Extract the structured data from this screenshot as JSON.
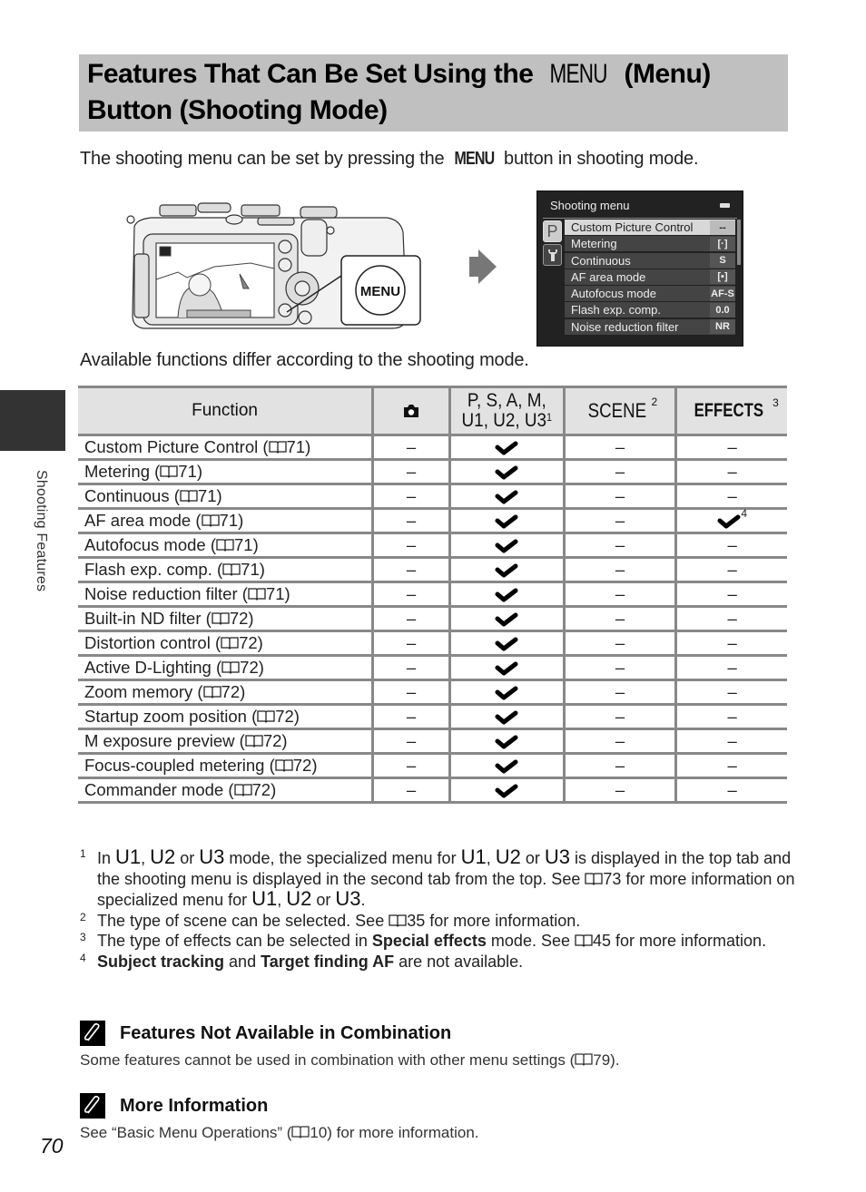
{
  "page": {
    "title_line1_pre": "Features That Can Be Set Using the ",
    "title_menu_glyph": "MENU",
    "title_line1_post": " (Menu)",
    "title_line2": "Button (Shooting Mode)",
    "intro_pre": "The shooting menu can be set by pressing the ",
    "intro_menu": "MENU",
    "intro_post": " button in shooting mode.",
    "available_text": "Available functions differ according to the shooting mode.",
    "side_label": "Shooting Features",
    "page_number": "70"
  },
  "illustration": {
    "camera_button_label": "MENU",
    "menu_screen": {
      "title": "Shooting menu",
      "tabs": [
        {
          "icon": "P",
          "name": "shooting-mode-tab",
          "active": true
        },
        {
          "icon": "wrench",
          "name": "setup-tab",
          "active": false
        }
      ],
      "items": [
        {
          "label": "Custom Picture Control",
          "value": "--",
          "selected": true
        },
        {
          "label": "Metering",
          "value": "[·]",
          "selected": false
        },
        {
          "label": "Continuous",
          "value": "S",
          "selected": false
        },
        {
          "label": "AF area mode",
          "value": "[▪]",
          "selected": false
        },
        {
          "label": "Autofocus mode",
          "value": "AF-S",
          "selected": false
        },
        {
          "label": "Flash exp. comp.",
          "value": "0.0",
          "selected": false
        },
        {
          "label": "Noise reduction filter",
          "value": "NR",
          "selected": false
        }
      ]
    }
  },
  "table": {
    "headers": {
      "function": "Function",
      "auto": "camera-icon",
      "psam_line1": "P, S, A, M,",
      "psam_line2": "U1, U2, U3",
      "psam_sup": "1",
      "scene": "SCENE",
      "scene_sup": "2",
      "effects": "EFFECTS",
      "effects_sup": "3"
    },
    "dash": "–",
    "rows": [
      {
        "function": "Custom Picture Control (",
        "page": "71)",
        "auto": "–",
        "psam": "check",
        "scene": "–",
        "effects": "–"
      },
      {
        "function": "Metering (",
        "page": "71)",
        "auto": "–",
        "psam": "check",
        "scene": "–",
        "effects": "–"
      },
      {
        "function": "Continuous (",
        "page": "71)",
        "auto": "–",
        "psam": "check",
        "scene": "–",
        "effects": "–"
      },
      {
        "function": "AF area mode (",
        "page": "71)",
        "auto": "–",
        "psam": "check",
        "scene": "–",
        "effects": "check",
        "effects_sup": "4"
      },
      {
        "function": "Autofocus mode (",
        "page": "71)",
        "auto": "–",
        "psam": "check",
        "scene": "–",
        "effects": "–"
      },
      {
        "function": "Flash exp. comp. (",
        "page": "71)",
        "auto": "–",
        "psam": "check",
        "scene": "–",
        "effects": "–"
      },
      {
        "function": "Noise reduction filter (",
        "page": "71)",
        "auto": "–",
        "psam": "check",
        "scene": "–",
        "effects": "–"
      },
      {
        "function": "Built-in ND filter (",
        "page": "72)",
        "auto": "–",
        "psam": "check",
        "scene": "–",
        "effects": "–"
      },
      {
        "function": "Distortion control (",
        "page": "72)",
        "auto": "–",
        "psam": "check",
        "scene": "–",
        "effects": "–"
      },
      {
        "function": "Active D-Lighting (",
        "page": "72)",
        "auto": "–",
        "psam": "check",
        "scene": "–",
        "effects": "–"
      },
      {
        "function": "Zoom memory (",
        "page": "72)",
        "auto": "–",
        "psam": "check",
        "scene": "–",
        "effects": "–"
      },
      {
        "function": "Startup zoom position (",
        "page": "72)",
        "auto": "–",
        "psam": "check",
        "scene": "–",
        "effects": "–"
      },
      {
        "function": "M exposure preview (",
        "page": "72)",
        "auto": "–",
        "psam": "check",
        "scene": "–",
        "effects": "–"
      },
      {
        "function": "Focus-coupled metering (",
        "page": "72)",
        "auto": "–",
        "psam": "check",
        "scene": "–",
        "effects": "–"
      },
      {
        "function": "Commander mode (",
        "page": "72)",
        "auto": "–",
        "psam": "check",
        "scene": "–",
        "effects": "–"
      }
    ]
  },
  "footnotes": {
    "fn1": {
      "num": "1",
      "t1": "In ",
      "u1": "U1",
      "t2": ", ",
      "u2": "U2",
      "t3": " or ",
      "u3": "U3",
      "t4": " mode, the specialized menu for ",
      "u4": "U1",
      "t5": ", ",
      "u5": "U2",
      "t6": " or ",
      "u6": "U3",
      "t7": " is displayed in the top tab and the shooting menu is displayed in the second tab from the top. See ",
      "t8": "73 for more information on specialized menu for ",
      "u7": "U1",
      "t9": ", ",
      "u8": "U2",
      "t10": " or ",
      "u9": "U3",
      "t11": "."
    },
    "fn2": {
      "num": "2",
      "t1": "The type of scene can be selected. See ",
      "t2": "35 for more information."
    },
    "fn3": {
      "num": "3",
      "t1": "The type of effects can be selected in ",
      "b1": "Special effects",
      "t2": " mode. See ",
      "t3": "45 for more information."
    },
    "fn4": {
      "num": "4",
      "b1": "Subject tracking",
      "t1": " and ",
      "b2": "Target finding AF",
      "t2": " are not available."
    }
  },
  "notes": [
    {
      "heading": "Features Not Available in Combination",
      "text_pre": "Some features cannot be used in combination with other menu settings (",
      "text_post": "79)."
    },
    {
      "heading": "More Information",
      "text_pre": "See “Basic Menu Operations” (",
      "text_post": "10) for more information."
    }
  ]
}
